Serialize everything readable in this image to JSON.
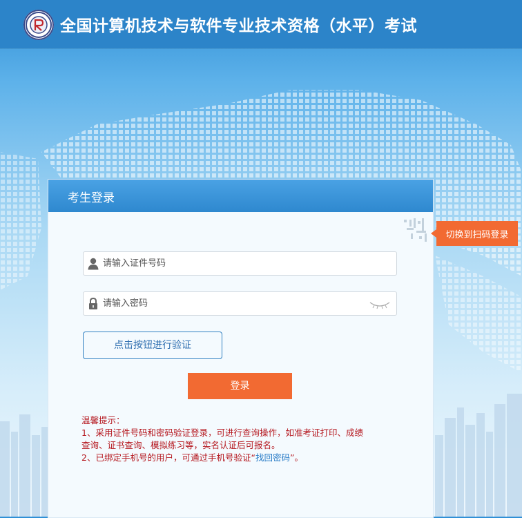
{
  "header": {
    "title": "全国计算机技术与软件专业技术资格（水平）考试"
  },
  "panel": {
    "title": "考生登录",
    "qr_switch_label": "切换到扫码登录"
  },
  "form": {
    "id_placeholder": "请输入证件号码",
    "password_placeholder": "请输入密码",
    "verify_label": "点击按钮进行验证",
    "login_label": "登录"
  },
  "tips": {
    "heading": "温馨提示：",
    "line1": "1、采用证件号码和密码验证登录，可进行查询操作，如准考证打印、成绩",
    "line2": "查询、证书查询、模拟练习等，实名认证后可报名。",
    "line3_prefix": "2、已绑定手机号的用户，可通过手机号验证“",
    "line3_link": "找回密码",
    "line3_suffix": "”。"
  },
  "colors": {
    "header_bg": "#2c84c9",
    "accent_orange": "#f26a32",
    "tip_red": "#b5171e",
    "link_blue": "#2a7cc7"
  },
  "icons": {
    "logo": "exam-logo",
    "user": "user-icon",
    "lock": "lock-icon",
    "eye": "eye-closed-icon",
    "qr": "qr-code-icon"
  }
}
